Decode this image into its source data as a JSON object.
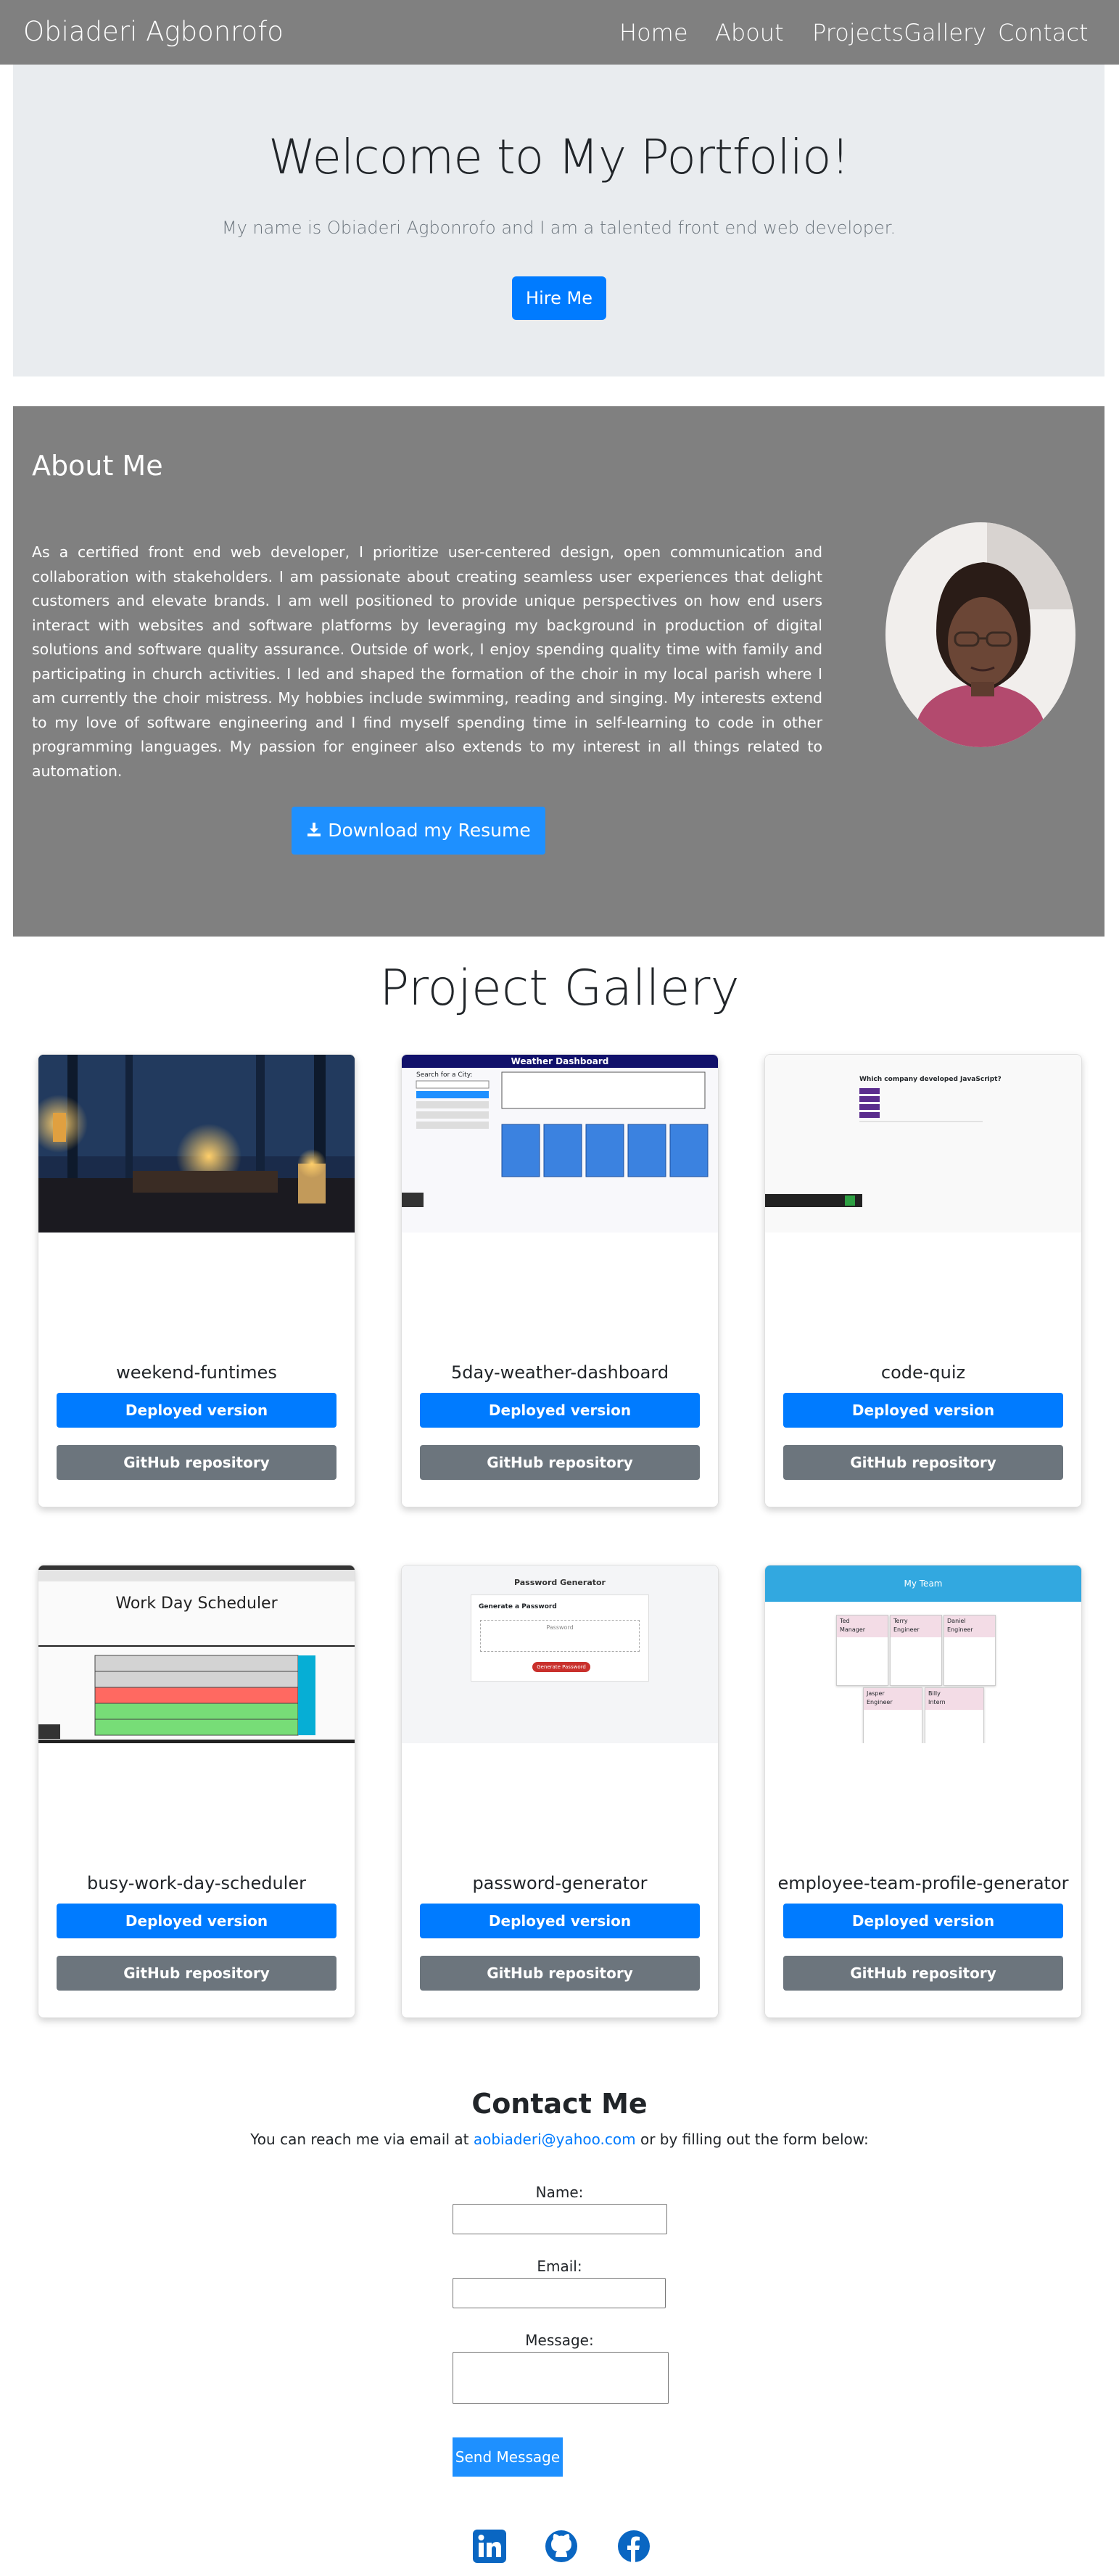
{
  "navbar": {
    "brand": "Obiaderi Agbonrofo",
    "links": [
      "Home",
      "About",
      "ProjectsGallery",
      "Contact"
    ]
  },
  "hero": {
    "title": "Welcome to My Portfolio!",
    "lead": "My name is Obiaderi Agbonrofo and I am a talented front end web developer.",
    "button": "Hire Me"
  },
  "about": {
    "heading": "About Me",
    "body": "As a certified front end web developer, I prioritize user-centered design, open communication and collaboration with stakeholders. I am passionate about creating seamless user experiences that delight customers and elevate brands. I am well positioned to provide unique perspectives on how end users interact with websites and software platforms by leveraging my background in production of digital solutions and software quality assurance. Outside of work, I enjoy spending quality time with family and participating in church activities. I led and shaped the formation of the choir in my local parish where I am currently the choir mistress. My hobbies include swimming, reading and singing. My interests extend to my love of software engineering and I find myself spending time in self-learning to code in other programming languages. My passion for engineer also extends to my interest in all things related to automation.",
    "resume_button": "Download my Resume"
  },
  "gallery": {
    "title": "Project Gallery",
    "deployed_label": "Deployed version",
    "github_label": "GitHub repository",
    "projects": [
      {
        "name": "weekend-funtimes"
      },
      {
        "name": "5day-weather-dashboard"
      },
      {
        "name": "code-quiz"
      },
      {
        "name": "busy-work-day-scheduler"
      },
      {
        "name": "password-generator"
      },
      {
        "name": "employee-team-profile-generator"
      }
    ],
    "thumbs": {
      "weather": {
        "header": "Weather Dashboard",
        "search": "Search for a City:"
      },
      "quiz": {
        "question": "Which company developed JavaScript?"
      },
      "scheduler": {
        "title": "Work Day Scheduler"
      },
      "password": {
        "title": "Password Generator",
        "card": "Generate a Password",
        "placeholder": "Password",
        "button": "Generate Password"
      },
      "team": {
        "header": "My Team",
        "members": [
          {
            "name": "Ted",
            "role": "Manager"
          },
          {
            "name": "Terry",
            "role": "Engineer"
          },
          {
            "name": "Daniel",
            "role": "Engineer"
          },
          {
            "name": "Jasper",
            "role": "Engineer"
          },
          {
            "name": "Billy",
            "role": "Intern"
          }
        ]
      }
    }
  },
  "contact": {
    "heading": "Contact Me",
    "text_before": "You can reach me via email at ",
    "email": "aobiaderi@yahoo.com",
    "text_after": " or by filling out the form below:",
    "name_label": "Name:",
    "email_label": "Email:",
    "message_label": "Message:",
    "send_button": "Send Message"
  },
  "social": [
    "linkedin-icon",
    "github-icon",
    "facebook-icon"
  ],
  "colors": {
    "primary": "#007bff",
    "secondary": "#6c757d",
    "navbar": "#808080",
    "jumbotron": "#e9ecef"
  }
}
